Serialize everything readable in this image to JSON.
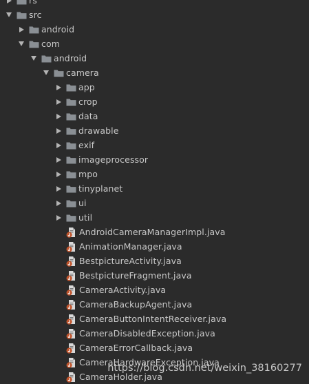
{
  "colors": {
    "background": "#2b2b2b",
    "text": "#c9c9c9",
    "folder": "#8a8f94",
    "java_badge": "#c0542c"
  },
  "tree": [
    {
      "label": "rs",
      "depth": 1,
      "type": "folder",
      "state": "collapsed"
    },
    {
      "label": "src",
      "depth": 1,
      "type": "folder",
      "state": "expanded"
    },
    {
      "label": "android",
      "depth": 2,
      "type": "folder",
      "state": "collapsed"
    },
    {
      "label": "com",
      "depth": 2,
      "type": "folder",
      "state": "expanded"
    },
    {
      "label": "android",
      "depth": 3,
      "type": "folder",
      "state": "expanded"
    },
    {
      "label": "camera",
      "depth": 4,
      "type": "folder",
      "state": "expanded"
    },
    {
      "label": "app",
      "depth": 5,
      "type": "folder",
      "state": "collapsed"
    },
    {
      "label": "crop",
      "depth": 5,
      "type": "folder",
      "state": "collapsed"
    },
    {
      "label": "data",
      "depth": 5,
      "type": "folder",
      "state": "collapsed"
    },
    {
      "label": "drawable",
      "depth": 5,
      "type": "folder",
      "state": "collapsed"
    },
    {
      "label": "exif",
      "depth": 5,
      "type": "folder",
      "state": "collapsed"
    },
    {
      "label": "imageprocessor",
      "depth": 5,
      "type": "folder",
      "state": "collapsed"
    },
    {
      "label": "mpo",
      "depth": 5,
      "type": "folder",
      "state": "collapsed"
    },
    {
      "label": "tinyplanet",
      "depth": 5,
      "type": "folder",
      "state": "collapsed"
    },
    {
      "label": "ui",
      "depth": 5,
      "type": "folder",
      "state": "collapsed"
    },
    {
      "label": "util",
      "depth": 5,
      "type": "folder",
      "state": "collapsed"
    },
    {
      "label": "AndroidCameraManagerImpl.java",
      "depth": 5,
      "type": "java"
    },
    {
      "label": "AnimationManager.java",
      "depth": 5,
      "type": "java"
    },
    {
      "label": "BestpictureActivity.java",
      "depth": 5,
      "type": "java"
    },
    {
      "label": "BestpictureFragment.java",
      "depth": 5,
      "type": "java"
    },
    {
      "label": "CameraActivity.java",
      "depth": 5,
      "type": "java"
    },
    {
      "label": "CameraBackupAgent.java",
      "depth": 5,
      "type": "java"
    },
    {
      "label": "CameraButtonIntentReceiver.java",
      "depth": 5,
      "type": "java"
    },
    {
      "label": "CameraDisabledException.java",
      "depth": 5,
      "type": "java"
    },
    {
      "label": "CameraErrorCallback.java",
      "depth": 5,
      "type": "java"
    },
    {
      "label": "CameraHardwareException.java",
      "depth": 5,
      "type": "java"
    },
    {
      "label": "CameraHolder.java",
      "depth": 5,
      "type": "java"
    }
  ],
  "watermark": "https://blog.csdn.net/weixin_38160277"
}
